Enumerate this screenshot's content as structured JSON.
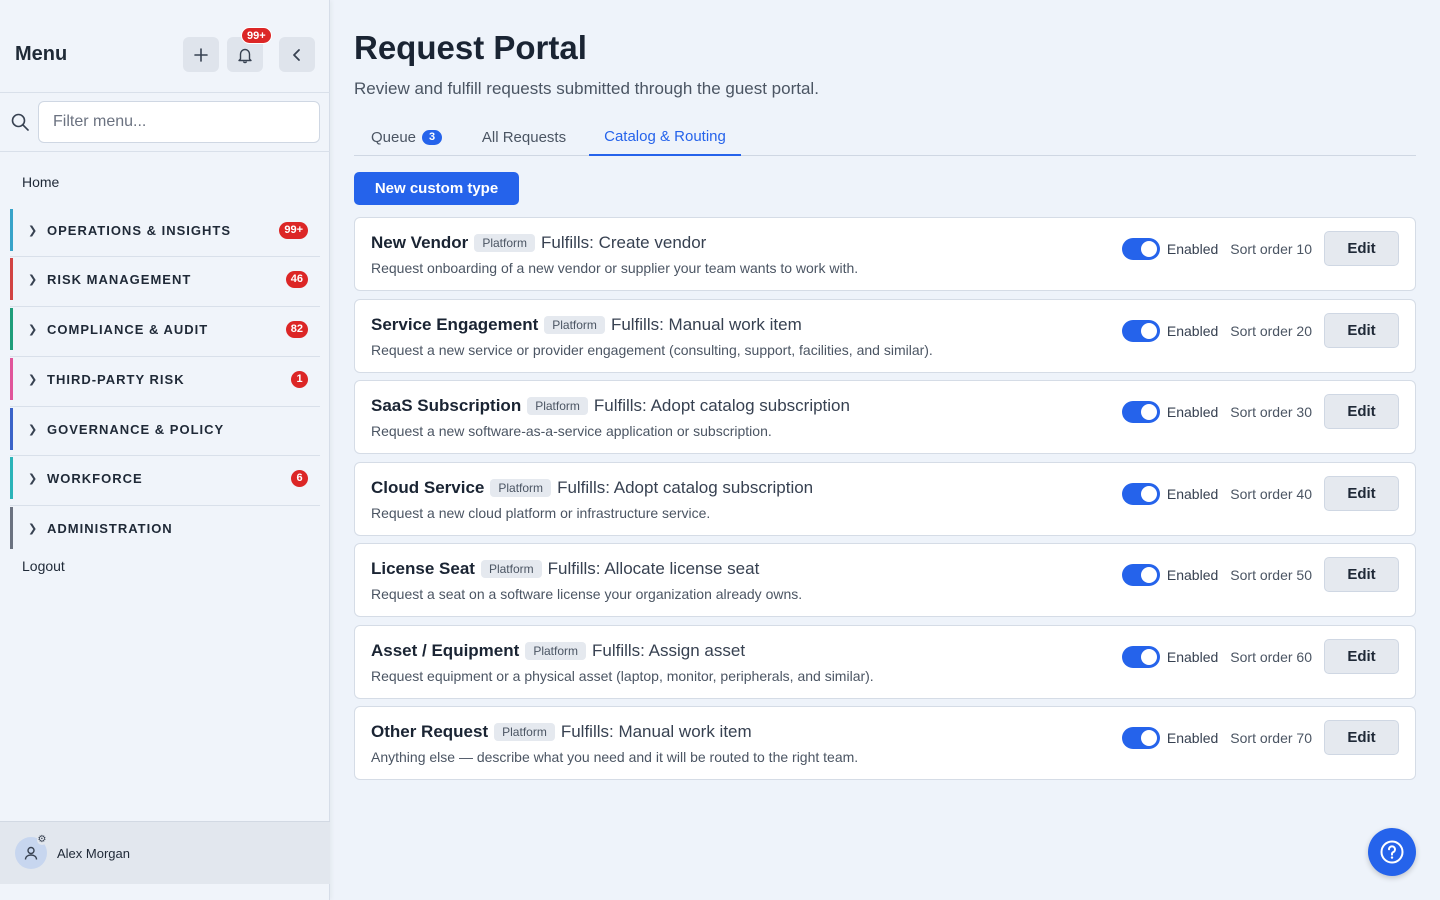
{
  "sidebar": {
    "title": "Menu",
    "notifications_badge": "99+",
    "filter_placeholder": "Filter menu...",
    "home_label": "Home",
    "logout_label": "Logout",
    "groups": [
      {
        "label": "OPERATIONS & INSIGHTS",
        "count": "99+",
        "color": "#38a3c9"
      },
      {
        "label": "RISK MANAGEMENT",
        "count": "46",
        "color": "#d14343"
      },
      {
        "label": "COMPLIANCE & AUDIT",
        "count": "82",
        "color": "#1f9d7a"
      },
      {
        "label": "THIRD-PARTY RISK",
        "count": "1",
        "color": "#e0559a"
      },
      {
        "label": "GOVERNANCE & POLICY",
        "count": "",
        "color": "#3a63c8"
      },
      {
        "label": "WORKFORCE",
        "count": "6",
        "color": "#2bb3b8"
      },
      {
        "label": "ADMINISTRATION",
        "count": "",
        "color": "#6b7280"
      }
    ],
    "user_name": "Alex Morgan"
  },
  "main": {
    "title": "Request Portal",
    "subtitle": "Review and fulfill requests submitted through the guest portal.",
    "tabs": [
      {
        "label": "Queue",
        "count": "3"
      },
      {
        "label": "All Requests"
      },
      {
        "label": "Catalog & Routing",
        "active": true
      }
    ],
    "new_button": "New custom type",
    "cards": [
      {
        "name": "New Vendor",
        "tag": "Platform",
        "fulfills": "Fulfills: Create vendor",
        "description": "Request onboarding of a new vendor or supplier your team wants to work with.",
        "enabled_label": "Enabled",
        "sort_label": "Sort order 10",
        "edit_label": "Edit"
      },
      {
        "name": "Service Engagement",
        "tag": "Platform",
        "fulfills": "Fulfills: Manual work item",
        "description": "Request a new service or provider engagement (consulting, support, facilities, and similar).",
        "enabled_label": "Enabled",
        "sort_label": "Sort order 20",
        "edit_label": "Edit"
      },
      {
        "name": "SaaS Subscription",
        "tag": "Platform",
        "fulfills": "Fulfills: Adopt catalog subscription",
        "description": "Request a new software-as-a-service application or subscription.",
        "enabled_label": "Enabled",
        "sort_label": "Sort order 30",
        "edit_label": "Edit"
      },
      {
        "name": "Cloud Service",
        "tag": "Platform",
        "fulfills": "Fulfills: Adopt catalog subscription",
        "description": "Request a new cloud platform or infrastructure service.",
        "enabled_label": "Enabled",
        "sort_label": "Sort order 40",
        "edit_label": "Edit"
      },
      {
        "name": "License Seat",
        "tag": "Platform",
        "fulfills": "Fulfills: Allocate license seat",
        "description": "Request a seat on a software license your organization already owns.",
        "enabled_label": "Enabled",
        "sort_label": "Sort order 50",
        "edit_label": "Edit"
      },
      {
        "name": "Asset / Equipment",
        "tag": "Platform",
        "fulfills": "Fulfills: Assign asset",
        "description": "Request equipment or a physical asset (laptop, monitor, peripherals, and similar).",
        "enabled_label": "Enabled",
        "sort_label": "Sort order 60",
        "edit_label": "Edit"
      },
      {
        "name": "Other Request",
        "tag": "Platform",
        "fulfills": "Fulfills: Manual work item",
        "description": "Anything else — describe what you need and it will be routed to the right team.",
        "enabled_label": "Enabled",
        "sort_label": "Sort order 70",
        "edit_label": "Edit"
      }
    ]
  },
  "colors": {
    "accent": "#2563eb",
    "badge": "#dc2626"
  },
  "icons": {
    "add": "plus-icon",
    "notifications": "bell-icon",
    "collapse": "chevron-left-icon",
    "filter": "search-icon",
    "help": "help-circle-icon",
    "avatar": "user-icon"
  }
}
